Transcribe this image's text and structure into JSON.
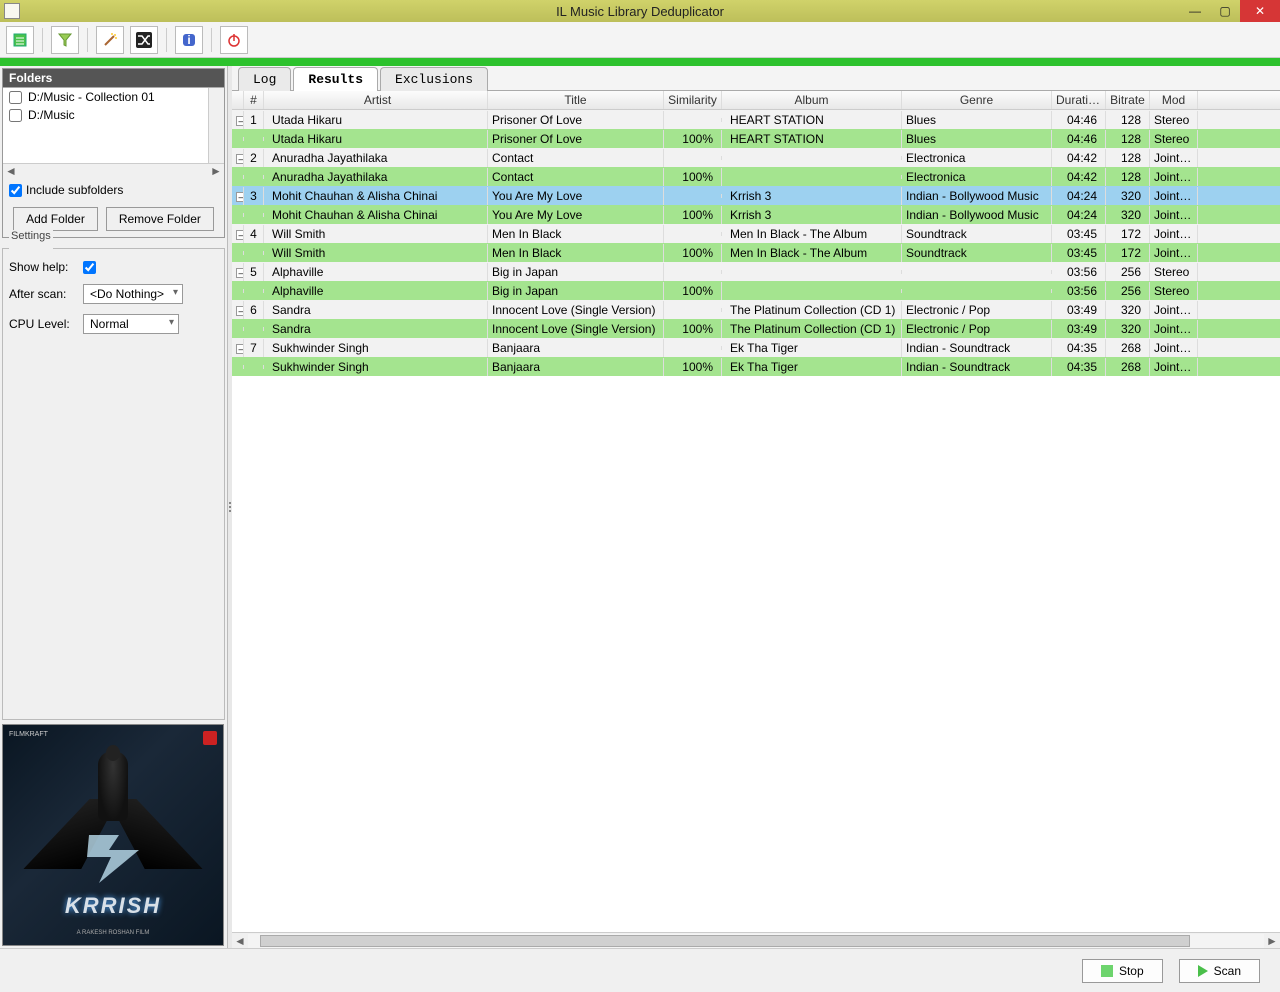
{
  "window": {
    "title": "IL Music Library Deduplicator"
  },
  "sidebar": {
    "folders_header": "Folders",
    "folders": [
      {
        "label": "D:/Music - Collection 01",
        "checked": false
      },
      {
        "label": "D:/Music",
        "checked": false
      }
    ],
    "include_subfolders_label": "Include subfolders",
    "include_subfolders_checked": true,
    "add_folder_label": "Add Folder",
    "remove_folder_label": "Remove Folder"
  },
  "settings": {
    "legend": "Settings",
    "show_help_label": "Show help:",
    "show_help_checked": true,
    "after_scan_label": "After scan:",
    "after_scan_value": "<Do Nothing>",
    "cpu_level_label": "CPU Level:",
    "cpu_level_value": "Normal"
  },
  "album_art": {
    "title_text": "KRRISH",
    "subtitle": "A RAKESH ROSHAN FILM",
    "studio": "FILMKRAFT"
  },
  "tabs": [
    {
      "id": "log",
      "label": "Log",
      "active": false
    },
    {
      "id": "results",
      "label": "Results",
      "active": true
    },
    {
      "id": "exclusions",
      "label": "Exclusions",
      "active": false
    }
  ],
  "columns": {
    "idx": "#",
    "artist": "Artist",
    "title": "Title",
    "similarity": "Similarity",
    "album": "Album",
    "genre": "Genre",
    "duration": "Duration",
    "bitrate": "Bitrate",
    "mode": "Mod"
  },
  "rows": [
    {
      "group": 1,
      "selected": false,
      "kind": "head",
      "artist": "Utada Hikaru",
      "title": "Prisoner Of Love",
      "sim": "",
      "album": "HEART STATION",
      "genre": "Blues",
      "dur": "04:46",
      "br": "128",
      "mode": "Stereo"
    },
    {
      "group": 1,
      "selected": false,
      "kind": "dup",
      "artist": "Utada Hikaru",
      "title": "Prisoner Of Love",
      "sim": "100%",
      "album": "HEART STATION",
      "genre": "Blues",
      "dur": "04:46",
      "br": "128",
      "mode": "Stereo"
    },
    {
      "group": 2,
      "selected": false,
      "kind": "head",
      "artist": "Anuradha Jayathilaka",
      "title": "Contact",
      "sim": "",
      "album": "",
      "genre": "Electronica",
      "dur": "04:42",
      "br": "128",
      "mode": "JointSte"
    },
    {
      "group": 2,
      "selected": false,
      "kind": "dup",
      "artist": "Anuradha Jayathilaka",
      "title": "Contact",
      "sim": "100%",
      "album": "",
      "genre": "Electronica",
      "dur": "04:42",
      "br": "128",
      "mode": "JointSte"
    },
    {
      "group": 3,
      "selected": true,
      "kind": "head",
      "artist": "Mohit Chauhan & Alisha Chinai",
      "title": "You Are My Love",
      "sim": "",
      "album": "Krrish 3",
      "genre": "Indian - Bollywood Music",
      "dur": "04:24",
      "br": "320",
      "mode": "JointSte"
    },
    {
      "group": 3,
      "selected": false,
      "kind": "dup",
      "artist": "Mohit Chauhan & Alisha Chinai",
      "title": "You Are My Love",
      "sim": "100%",
      "album": "Krrish 3",
      "genre": "Indian - Bollywood Music",
      "dur": "04:24",
      "br": "320",
      "mode": "JointSte"
    },
    {
      "group": 4,
      "selected": false,
      "kind": "head",
      "artist": "Will Smith",
      "title": "Men In Black",
      "sim": "",
      "album": "Men In Black - The Album",
      "genre": "Soundtrack",
      "dur": "03:45",
      "br": "172",
      "mode": "JointSte"
    },
    {
      "group": 4,
      "selected": false,
      "kind": "dup",
      "artist": "Will Smith",
      "title": "Men In Black",
      "sim": "100%",
      "album": "Men In Black - The Album",
      "genre": "Soundtrack",
      "dur": "03:45",
      "br": "172",
      "mode": "JointSte"
    },
    {
      "group": 5,
      "selected": false,
      "kind": "head",
      "artist": "Alphaville",
      "title": "Big in Japan",
      "sim": "",
      "album": "",
      "genre": "",
      "dur": "03:56",
      "br": "256",
      "mode": "Stereo"
    },
    {
      "group": 5,
      "selected": false,
      "kind": "dup",
      "artist": "Alphaville",
      "title": "Big in Japan",
      "sim": "100%",
      "album": "",
      "genre": "",
      "dur": "03:56",
      "br": "256",
      "mode": "Stereo"
    },
    {
      "group": 6,
      "selected": false,
      "kind": "head",
      "artist": "Sandra",
      "title": "Innocent Love (Single Version)",
      "sim": "",
      "album": "The Platinum Collection (CD 1)",
      "genre": "Electronic / Pop",
      "dur": "03:49",
      "br": "320",
      "mode": "JointSte"
    },
    {
      "group": 6,
      "selected": false,
      "kind": "dup",
      "artist": "Sandra",
      "title": "Innocent Love (Single Version)",
      "sim": "100%",
      "album": "The Platinum Collection (CD 1)",
      "genre": "Electronic / Pop",
      "dur": "03:49",
      "br": "320",
      "mode": "JointSte"
    },
    {
      "group": 7,
      "selected": false,
      "kind": "head",
      "artist": "Sukhwinder Singh",
      "title": "Banjaara",
      "sim": "",
      "album": "Ek Tha Tiger",
      "genre": "Indian - Soundtrack",
      "dur": "04:35",
      "br": "268",
      "mode": "JointSte"
    },
    {
      "group": 7,
      "selected": false,
      "kind": "dup",
      "artist": "Sukhwinder Singh",
      "title": "Banjaara",
      "sim": "100%",
      "album": "Ek Tha Tiger",
      "genre": "Indian - Soundtrack",
      "dur": "04:35",
      "br": "268",
      "mode": "JointSte"
    }
  ],
  "footer": {
    "stop_label": "Stop",
    "scan_label": "Scan"
  }
}
